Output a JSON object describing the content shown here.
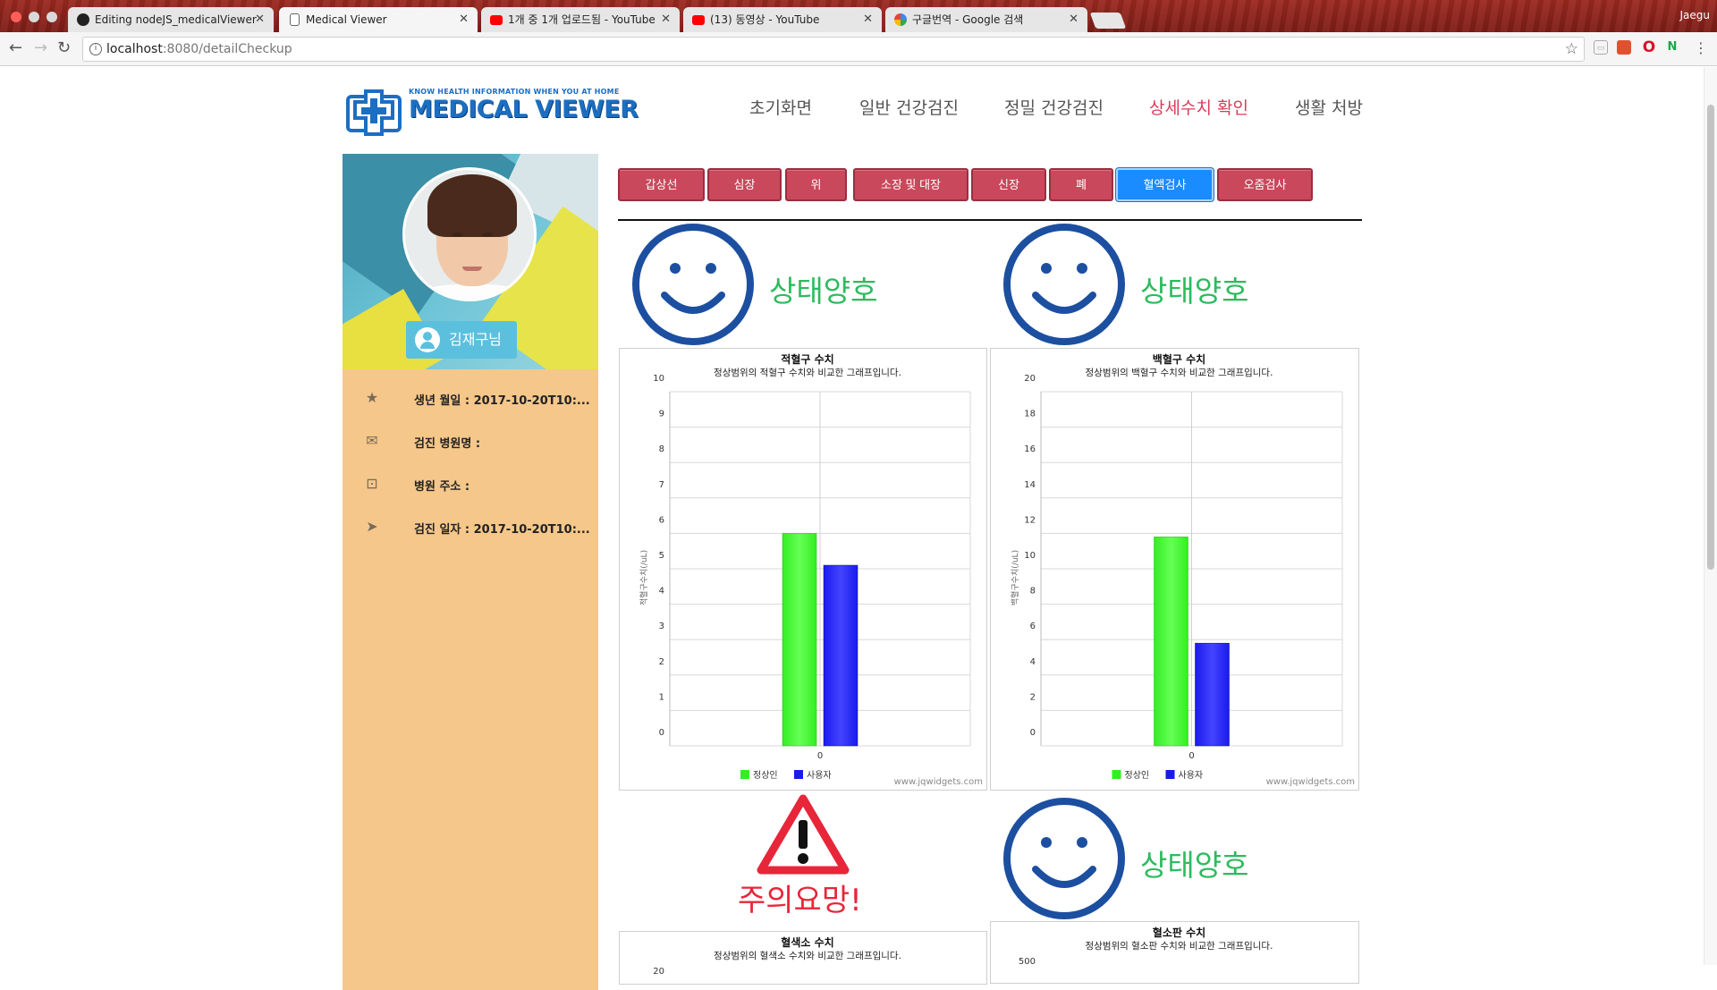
{
  "browser": {
    "tabs": [
      {
        "title": "Editing nodeJS_medicalViewer",
        "icon": "github-icon"
      },
      {
        "title": "Medical Viewer",
        "icon": "document-icon"
      },
      {
        "title": "1개 중 1개 업로드됨 - YouTube",
        "icon": "youtube-icon"
      },
      {
        "title": "(13) 동영상 - YouTube",
        "icon": "youtube-icon"
      },
      {
        "title": "구글번역 - Google 검색",
        "icon": "google-icon"
      }
    ],
    "profile_name": "Jaegu",
    "url_host": "localhost",
    "url_path": ":8080/detailCheckup"
  },
  "logo": {
    "tagline": "KNOW HEALTH INFORMATION WHEN YOU AT HOME",
    "title": "MEDICAL VIEWER"
  },
  "nav": [
    {
      "label": "초기화면"
    },
    {
      "label": "일반 건강검진"
    },
    {
      "label": "정밀 건강검진"
    },
    {
      "label": "상세수치 확인",
      "active": true
    },
    {
      "label": "생활 처방"
    }
  ],
  "profile": {
    "name": "김재구님",
    "birth": "생년 월일 : 2017-10-20T10:...",
    "hospital": "검진 병원명 :",
    "address": "병원 주소 :",
    "checkup_date": "검진 일자 : 2017-10-20T10:..."
  },
  "categories": [
    {
      "label": "갑상선"
    },
    {
      "label": "심장"
    },
    {
      "label": "위"
    },
    {
      "label": "소장 및 대장"
    },
    {
      "label": "신장"
    },
    {
      "label": "폐"
    },
    {
      "label": "혈액검사",
      "active": true
    },
    {
      "label": "오줌검사"
    }
  ],
  "status": {
    "good_label": "상태양호",
    "warn_label": "주의요망!",
    "good_color": "#2dbb5e",
    "warn_color": "#e8263a"
  },
  "colors": {
    "normal": "#33ee22",
    "user": "#1a1aee",
    "accent": "#c9485b",
    "active_tab": "#1a8cff"
  },
  "watermark": "www.jqwidgets.com",
  "chart_data": [
    {
      "type": "bar",
      "title": "적혈구 수치",
      "subtitle": "정상범위의 적혈구 수치와 비교한 그래프입니다.",
      "ylabel": "적혈구수치(/uL)",
      "categories": [
        "0"
      ],
      "ylim": [
        0,
        10
      ],
      "yticks": [
        "0",
        "1",
        "2",
        "3",
        "4",
        "5",
        "6",
        "7",
        "8",
        "9",
        "10"
      ],
      "series": [
        {
          "name": "정상인",
          "values": [
            6
          ]
        },
        {
          "name": "사용자",
          "values": [
            5.1
          ]
        }
      ],
      "status": "good"
    },
    {
      "type": "bar",
      "title": "백혈구 수치",
      "subtitle": "정상범위의 백혈구 수치와 비교한 그래프입니다.",
      "ylabel": "백혈구수치(/uL)",
      "categories": [
        "0"
      ],
      "ylim": [
        0,
        20
      ],
      "yticks": [
        "0",
        "2",
        "4",
        "6",
        "8",
        "10",
        "12",
        "14",
        "16",
        "18",
        "20"
      ],
      "series": [
        {
          "name": "정상인",
          "values": [
            11.8
          ]
        },
        {
          "name": "사용자",
          "values": [
            5.8
          ]
        }
      ],
      "status": "good"
    },
    {
      "type": "bar",
      "title": "혈색소 수치",
      "subtitle": "정상범위의 혈색소 수치와 비교한 그래프입니다.",
      "ylabel": "",
      "categories": [],
      "ylim": [
        0,
        20
      ],
      "yticks": [
        "20"
      ],
      "series": [],
      "status": "warn"
    },
    {
      "type": "bar",
      "title": "혈소판 수치",
      "subtitle": "정상범위의 혈소판 수치와 비교한 그래프입니다.",
      "ylabel": "",
      "categories": [],
      "ylim": [
        0,
        500
      ],
      "yticks": [
        "500"
      ],
      "series": [],
      "status": "good"
    }
  ]
}
